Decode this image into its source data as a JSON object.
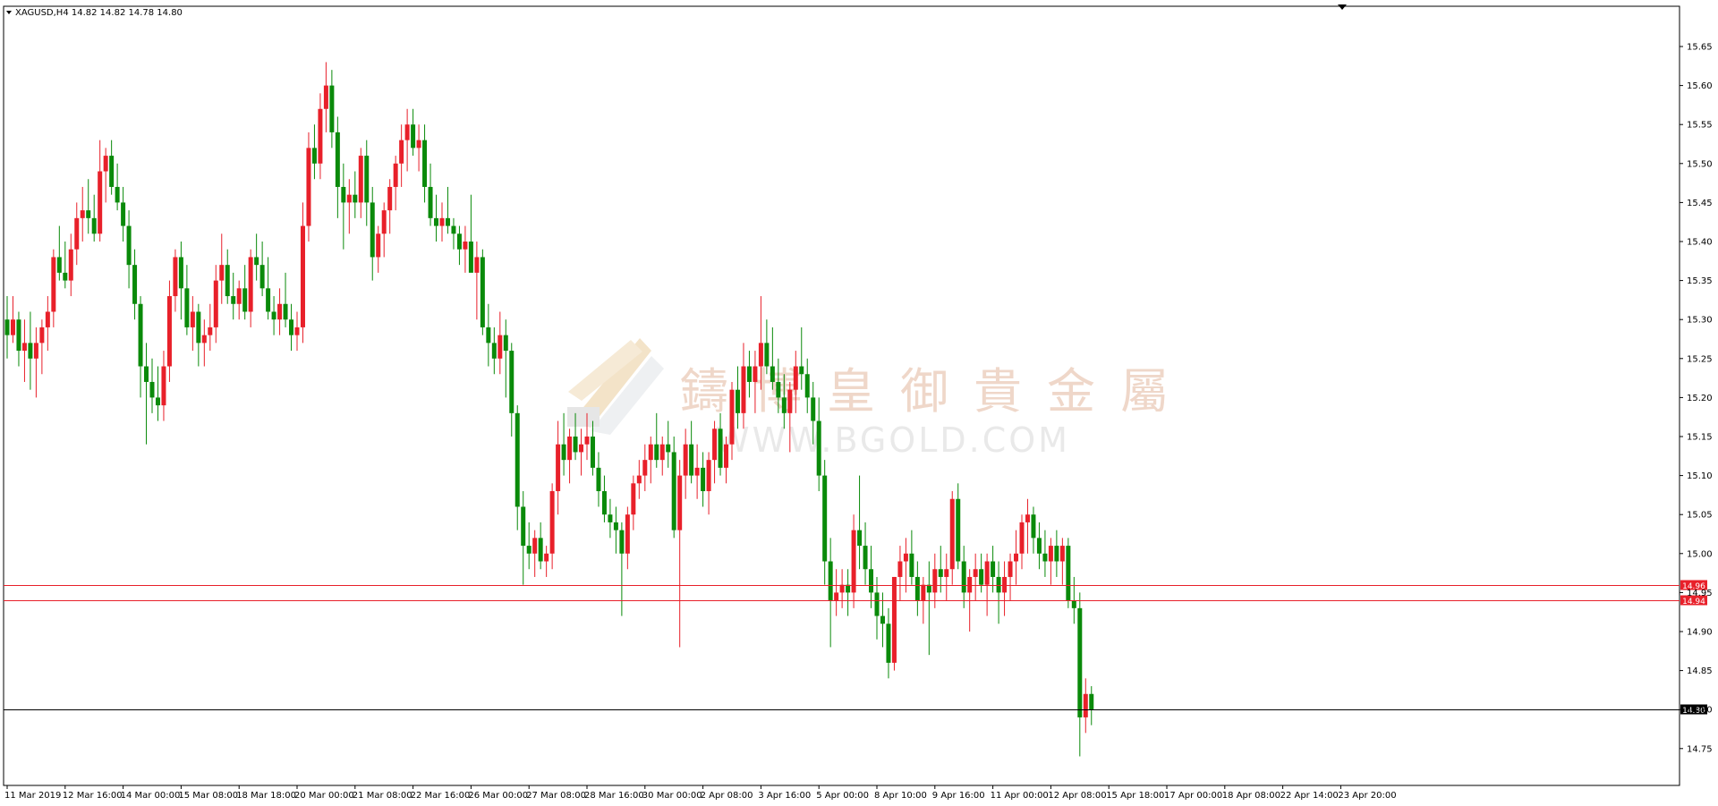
{
  "header": {
    "symbol_line": "XAGUSD,H4  14.82  14.82  14.78  14.80",
    "dropdown_icon": "triangle-down-icon"
  },
  "watermark": {
    "chinese": "鑄博皇御貴金屬",
    "english": "WWW.BGOLD.COM",
    "logo_icon": "gold-bars-logo-icon"
  },
  "colors": {
    "bull": "#e8202a",
    "bear": "#0a8a0a",
    "doji": "#55c255",
    "support_line": "#e8202a",
    "current_line": "#000000",
    "tag_red": "#e8202a",
    "tag_black": "#000000",
    "grid": "none"
  },
  "chart_data": {
    "type": "candlestick",
    "symbol": "XAGUSD",
    "timeframe": "H4",
    "grid": false,
    "ylim": [
      14.72,
      15.68
    ],
    "yticks": [
      14.75,
      14.8,
      14.85,
      14.9,
      14.95,
      15.0,
      15.05,
      15.1,
      15.15,
      15.2,
      15.25,
      15.3,
      15.35,
      15.4,
      15.45,
      15.5,
      15.55,
      15.6,
      15.65
    ],
    "ytick_labels": [
      "14.75",
      "14.80",
      "14.85",
      "14.90",
      "14.95",
      "15.00",
      "15.05",
      "15.10",
      "15.15",
      "15.20",
      "15.25",
      "15.30",
      "15.35",
      "15.40",
      "15.45",
      "15.50",
      "15.55",
      "15.60",
      "15.65"
    ],
    "xtick_labels": [
      {
        "label": "11 Mar 2019",
        "bar": 0
      },
      {
        "label": "12 Mar 16:00",
        "bar": 10
      },
      {
        "label": "14 Mar 00:00",
        "bar": 20
      },
      {
        "label": "15 Mar 08:00",
        "bar": 30
      },
      {
        "label": "18 Mar 18:00",
        "bar": 40
      },
      {
        "label": "20 Mar 00:00",
        "bar": 50
      },
      {
        "label": "21 Mar 08:00",
        "bar": 60
      },
      {
        "label": "22 Mar 16:00",
        "bar": 70
      },
      {
        "label": "26 Mar 00:00",
        "bar": 80
      },
      {
        "label": "27 Mar 08:00",
        "bar": 90
      },
      {
        "label": "28 Mar 16:00",
        "bar": 100
      },
      {
        "label": "30 Mar 00:00",
        "bar": 110
      },
      {
        "label": "2 Apr 08:00",
        "bar": 120
      },
      {
        "label": "3 Apr 16:00",
        "bar": 130
      },
      {
        "label": "5 Apr 00:00",
        "bar": 140
      },
      {
        "label": "8 Apr 10:00",
        "bar": 150
      },
      {
        "label": "9 Apr 16:00",
        "bar": 160
      },
      {
        "label": "11 Apr 00:00",
        "bar": 170
      },
      {
        "label": "12 Apr 08:00",
        "bar": 180
      },
      {
        "label": "15 Apr 18:00",
        "bar": 190
      },
      {
        "label": "17 Apr 00:00",
        "bar": 200
      },
      {
        "label": "18 Apr 08:00",
        "bar": 210
      },
      {
        "label": "22 Apr 14:00",
        "bar": 220
      },
      {
        "label": "23 Apr 20:00",
        "bar": 230
      }
    ],
    "hlines": [
      {
        "value": 14.96,
        "label": "14.96",
        "color": "#e8202a"
      },
      {
        "value": 14.94,
        "label": "14.94",
        "color": "#e8202a"
      },
      {
        "value": 14.8,
        "label": "14.80",
        "color": "#000000"
      }
    ],
    "ohlc": [
      [
        15.3,
        15.33,
        15.25,
        15.28
      ],
      [
        15.28,
        15.33,
        15.27,
        15.3
      ],
      [
        15.3,
        15.31,
        15.24,
        15.26
      ],
      [
        15.26,
        15.3,
        15.22,
        15.27
      ],
      [
        15.27,
        15.31,
        15.21,
        15.25
      ],
      [
        15.25,
        15.29,
        15.2,
        15.27
      ],
      [
        15.27,
        15.3,
        15.23,
        15.29
      ],
      [
        15.29,
        15.33,
        15.26,
        15.31
      ],
      [
        15.31,
        15.39,
        15.29,
        15.38
      ],
      [
        15.38,
        15.42,
        15.35,
        15.36
      ],
      [
        15.36,
        15.4,
        15.34,
        15.35
      ],
      [
        15.35,
        15.41,
        15.33,
        15.39
      ],
      [
        15.39,
        15.45,
        15.37,
        15.43
      ],
      [
        15.43,
        15.47,
        15.4,
        15.44
      ],
      [
        15.44,
        15.48,
        15.41,
        15.43
      ],
      [
        15.43,
        15.46,
        15.4,
        15.41
      ],
      [
        15.41,
        15.53,
        15.4,
        15.49
      ],
      [
        15.49,
        15.52,
        15.45,
        15.51
      ],
      [
        15.51,
        15.53,
        15.46,
        15.47
      ],
      [
        15.47,
        15.5,
        15.44,
        15.45
      ],
      [
        15.45,
        15.47,
        15.4,
        15.42
      ],
      [
        15.42,
        15.44,
        15.34,
        15.37
      ],
      [
        15.37,
        15.39,
        15.3,
        15.32
      ],
      [
        15.32,
        15.33,
        15.2,
        15.24
      ],
      [
        15.24,
        15.27,
        15.14,
        15.22
      ],
      [
        15.22,
        15.25,
        15.18,
        15.2
      ],
      [
        15.2,
        15.24,
        15.17,
        15.19
      ],
      [
        15.19,
        15.26,
        15.17,
        15.24
      ],
      [
        15.24,
        15.35,
        15.22,
        15.33
      ],
      [
        15.33,
        15.39,
        15.31,
        15.38
      ],
      [
        15.38,
        15.4,
        15.3,
        15.34
      ],
      [
        15.34,
        15.37,
        15.28,
        15.29
      ],
      [
        15.29,
        15.33,
        15.26,
        15.31
      ],
      [
        15.31,
        15.32,
        15.24,
        15.27
      ],
      [
        15.27,
        15.3,
        15.24,
        15.28
      ],
      [
        15.28,
        15.32,
        15.26,
        15.29
      ],
      [
        15.29,
        15.37,
        15.27,
        15.35
      ],
      [
        15.35,
        15.41,
        15.32,
        15.37
      ],
      [
        15.37,
        15.39,
        15.32,
        15.33
      ],
      [
        15.33,
        15.36,
        15.3,
        15.32
      ],
      [
        15.32,
        15.35,
        15.3,
        15.34
      ],
      [
        15.34,
        15.37,
        15.3,
        15.31
      ],
      [
        15.31,
        15.39,
        15.29,
        15.38
      ],
      [
        15.38,
        15.41,
        15.35,
        15.37
      ],
      [
        15.37,
        15.4,
        15.33,
        15.34
      ],
      [
        15.34,
        15.38,
        15.3,
        15.31
      ],
      [
        15.31,
        15.33,
        15.28,
        15.3
      ],
      [
        15.3,
        15.34,
        15.28,
        15.32
      ],
      [
        15.32,
        15.36,
        15.29,
        15.3
      ],
      [
        15.3,
        15.32,
        15.26,
        15.28
      ],
      [
        15.28,
        15.31,
        15.26,
        15.29
      ],
      [
        15.29,
        15.45,
        15.27,
        15.42
      ],
      [
        15.42,
        15.54,
        15.4,
        15.52
      ],
      [
        15.52,
        15.55,
        15.48,
        15.5
      ],
      [
        15.5,
        15.59,
        15.48,
        15.57
      ],
      [
        15.57,
        15.63,
        15.54,
        15.6
      ],
      [
        15.6,
        15.62,
        15.52,
        15.54
      ],
      [
        15.54,
        15.56,
        15.43,
        15.47
      ],
      [
        15.47,
        15.5,
        15.39,
        15.45
      ],
      [
        15.45,
        15.48,
        15.41,
        15.46
      ],
      [
        15.46,
        15.49,
        15.43,
        15.45
      ],
      [
        15.45,
        15.52,
        15.43,
        15.51
      ],
      [
        15.51,
        15.53,
        15.42,
        15.45
      ],
      [
        15.45,
        15.47,
        15.35,
        15.38
      ],
      [
        15.38,
        15.42,
        15.36,
        15.41
      ],
      [
        15.41,
        15.45,
        15.38,
        15.44
      ],
      [
        15.44,
        15.48,
        15.41,
        15.47
      ],
      [
        15.47,
        15.51,
        15.44,
        15.5
      ],
      [
        15.5,
        15.55,
        15.47,
        15.53
      ],
      [
        15.53,
        15.57,
        15.49,
        15.55
      ],
      [
        15.55,
        15.57,
        15.51,
        15.52
      ],
      [
        15.52,
        15.55,
        15.49,
        15.53
      ],
      [
        15.53,
        15.55,
        15.45,
        15.47
      ],
      [
        15.47,
        15.5,
        15.42,
        15.43
      ],
      [
        15.43,
        15.46,
        15.4,
        15.42
      ],
      [
        15.42,
        15.45,
        15.4,
        15.43
      ],
      [
        15.43,
        15.47,
        15.41,
        15.42
      ],
      [
        15.42,
        15.43,
        15.39,
        15.41
      ],
      [
        15.41,
        15.42,
        15.37,
        15.39
      ],
      [
        15.39,
        15.42,
        15.36,
        15.4
      ],
      [
        15.4,
        15.46,
        15.37,
        15.36
      ],
      [
        15.36,
        15.4,
        15.3,
        15.38
      ],
      [
        15.38,
        15.39,
        15.28,
        15.29
      ],
      [
        15.29,
        15.32,
        15.24,
        15.27
      ],
      [
        15.27,
        15.29,
        15.23,
        15.25
      ],
      [
        15.25,
        15.31,
        15.23,
        15.28
      ],
      [
        15.28,
        15.3,
        15.2,
        15.26
      ],
      [
        15.26,
        15.27,
        15.15,
        15.18
      ],
      [
        15.18,
        15.19,
        15.03,
        15.06
      ],
      [
        15.06,
        15.08,
        14.96,
        15.01
      ],
      [
        15.01,
        15.04,
        14.98,
        15.0
      ],
      [
        15.0,
        15.03,
        14.97,
        15.02
      ],
      [
        15.02,
        15.04,
        14.98,
        14.99
      ],
      [
        14.99,
        15.01,
        14.97,
        15.0
      ],
      [
        15.0,
        15.09,
        14.98,
        15.08
      ],
      [
        15.08,
        15.17,
        15.05,
        15.14
      ],
      [
        15.14,
        15.18,
        15.1,
        15.12
      ],
      [
        15.12,
        15.16,
        15.09,
        15.15
      ],
      [
        15.15,
        15.18,
        15.12,
        15.13
      ],
      [
        15.13,
        15.16,
        15.1,
        15.14
      ],
      [
        15.14,
        15.18,
        15.12,
        15.15
      ],
      [
        15.15,
        15.17,
        15.1,
        15.11
      ],
      [
        15.11,
        15.13,
        15.06,
        15.08
      ],
      [
        15.08,
        15.1,
        15.04,
        15.05
      ],
      [
        15.05,
        15.07,
        15.02,
        15.04
      ],
      [
        15.04,
        15.06,
        15.0,
        15.03
      ],
      [
        15.03,
        15.04,
        14.92,
        15.0
      ],
      [
        15.0,
        15.06,
        14.98,
        15.05
      ],
      [
        15.05,
        15.1,
        15.03,
        15.09
      ],
      [
        15.09,
        15.12,
        15.07,
        15.1
      ],
      [
        15.1,
        15.14,
        15.08,
        15.12
      ],
      [
        15.12,
        15.15,
        15.09,
        15.14
      ],
      [
        15.14,
        15.18,
        15.11,
        15.12
      ],
      [
        15.12,
        15.15,
        15.1,
        15.14
      ],
      [
        15.14,
        15.17,
        15.11,
        15.13
      ],
      [
        15.13,
        15.15,
        15.02,
        15.03
      ],
      [
        15.03,
        15.12,
        14.88,
        15.1
      ],
      [
        15.1,
        15.16,
        15.07,
        15.14
      ],
      [
        15.14,
        15.17,
        15.09,
        15.1
      ],
      [
        15.1,
        15.14,
        15.07,
        15.11
      ],
      [
        15.11,
        15.13,
        15.06,
        15.08
      ],
      [
        15.08,
        15.13,
        15.05,
        15.12
      ],
      [
        15.12,
        15.17,
        15.09,
        15.16
      ],
      [
        15.16,
        15.18,
        15.1,
        15.11
      ],
      [
        15.11,
        15.15,
        15.09,
        15.14
      ],
      [
        15.14,
        15.22,
        15.12,
        15.21
      ],
      [
        15.21,
        15.24,
        15.16,
        15.18
      ],
      [
        15.18,
        15.27,
        15.16,
        15.24
      ],
      [
        15.24,
        15.26,
        15.2,
        15.22
      ],
      [
        15.22,
        15.26,
        15.18,
        15.24
      ],
      [
        15.24,
        15.33,
        15.21,
        15.27
      ],
      [
        15.27,
        15.3,
        15.23,
        15.24
      ],
      [
        15.24,
        15.29,
        15.21,
        15.22
      ],
      [
        15.22,
        15.25,
        15.18,
        15.2
      ],
      [
        15.2,
        15.23,
        15.16,
        15.18
      ],
      [
        15.18,
        15.22,
        15.13,
        15.21
      ],
      [
        15.21,
        15.26,
        15.18,
        15.24
      ],
      [
        15.24,
        15.29,
        15.21,
        15.23
      ],
      [
        15.23,
        15.25,
        15.18,
        15.2
      ],
      [
        15.2,
        15.22,
        15.14,
        15.17
      ],
      [
        15.17,
        15.2,
        15.08,
        15.1
      ],
      [
        15.1,
        15.12,
        14.96,
        14.99
      ],
      [
        14.99,
        15.02,
        14.88,
        14.94
      ],
      [
        14.94,
        14.98,
        14.92,
        14.95
      ],
      [
        14.95,
        14.98,
        14.93,
        14.96
      ],
      [
        14.96,
        14.98,
        14.92,
        14.95
      ],
      [
        14.95,
        15.05,
        14.93,
        15.03
      ],
      [
        15.03,
        15.1,
        14.98,
        15.01
      ],
      [
        15.01,
        15.04,
        14.96,
        14.98
      ],
      [
        14.98,
        15.01,
        14.93,
        14.95
      ],
      [
        14.95,
        14.97,
        14.89,
        14.92
      ],
      [
        14.92,
        14.95,
        14.88,
        14.91
      ],
      [
        14.91,
        14.93,
        14.84,
        14.86
      ],
      [
        14.86,
        14.97,
        14.85,
        14.97
      ],
      [
        14.97,
        15.01,
        14.94,
        14.99
      ],
      [
        14.99,
        15.02,
        14.95,
        15.0
      ],
      [
        15.0,
        15.03,
        14.96,
        14.97
      ],
      [
        14.97,
        14.99,
        14.92,
        14.94
      ],
      [
        14.94,
        14.97,
        14.91,
        14.96
      ],
      [
        14.96,
        14.99,
        14.87,
        14.95
      ],
      [
        14.95,
        15.0,
        14.93,
        14.98
      ],
      [
        14.98,
        15.01,
        14.95,
        14.97
      ],
      [
        14.97,
        15.0,
        14.94,
        14.98
      ],
      [
        14.98,
        15.08,
        14.96,
        15.07
      ],
      [
        15.07,
        15.09,
        14.98,
        14.99
      ],
      [
        14.99,
        15.01,
        14.93,
        14.95
      ],
      [
        14.95,
        14.98,
        14.9,
        14.97
      ],
      [
        14.97,
        15.0,
        14.94,
        14.98
      ],
      [
        14.98,
        15.0,
        14.95,
        14.96
      ],
      [
        14.96,
        15.0,
        14.92,
        14.99
      ],
      [
        14.99,
        15.01,
        14.95,
        14.97
      ],
      [
        14.97,
        14.99,
        14.91,
        14.95
      ],
      [
        14.95,
        14.99,
        14.92,
        14.97
      ],
      [
        14.97,
        15.0,
        14.94,
        14.99
      ],
      [
        14.99,
        15.03,
        14.96,
        15.0
      ],
      [
        15.0,
        15.05,
        14.98,
        15.04
      ],
      [
        15.04,
        15.07,
        15.0,
        15.05
      ],
      [
        15.05,
        15.06,
        15.0,
        15.02
      ],
      [
        15.02,
        15.04,
        14.98,
        15.0
      ],
      [
        15.0,
        15.03,
        14.97,
        14.99
      ],
      [
        14.99,
        15.02,
        14.96,
        15.01
      ],
      [
        15.01,
        15.03,
        14.97,
        14.99
      ],
      [
        14.99,
        15.02,
        14.96,
        15.01
      ],
      [
        15.01,
        15.02,
        14.93,
        14.94
      ],
      [
        14.94,
        14.97,
        14.91,
        14.93
      ],
      [
        14.93,
        14.95,
        14.74,
        14.79
      ],
      [
        14.79,
        14.84,
        14.77,
        14.82
      ],
      [
        14.82,
        14.83,
        14.78,
        14.8
      ]
    ]
  }
}
